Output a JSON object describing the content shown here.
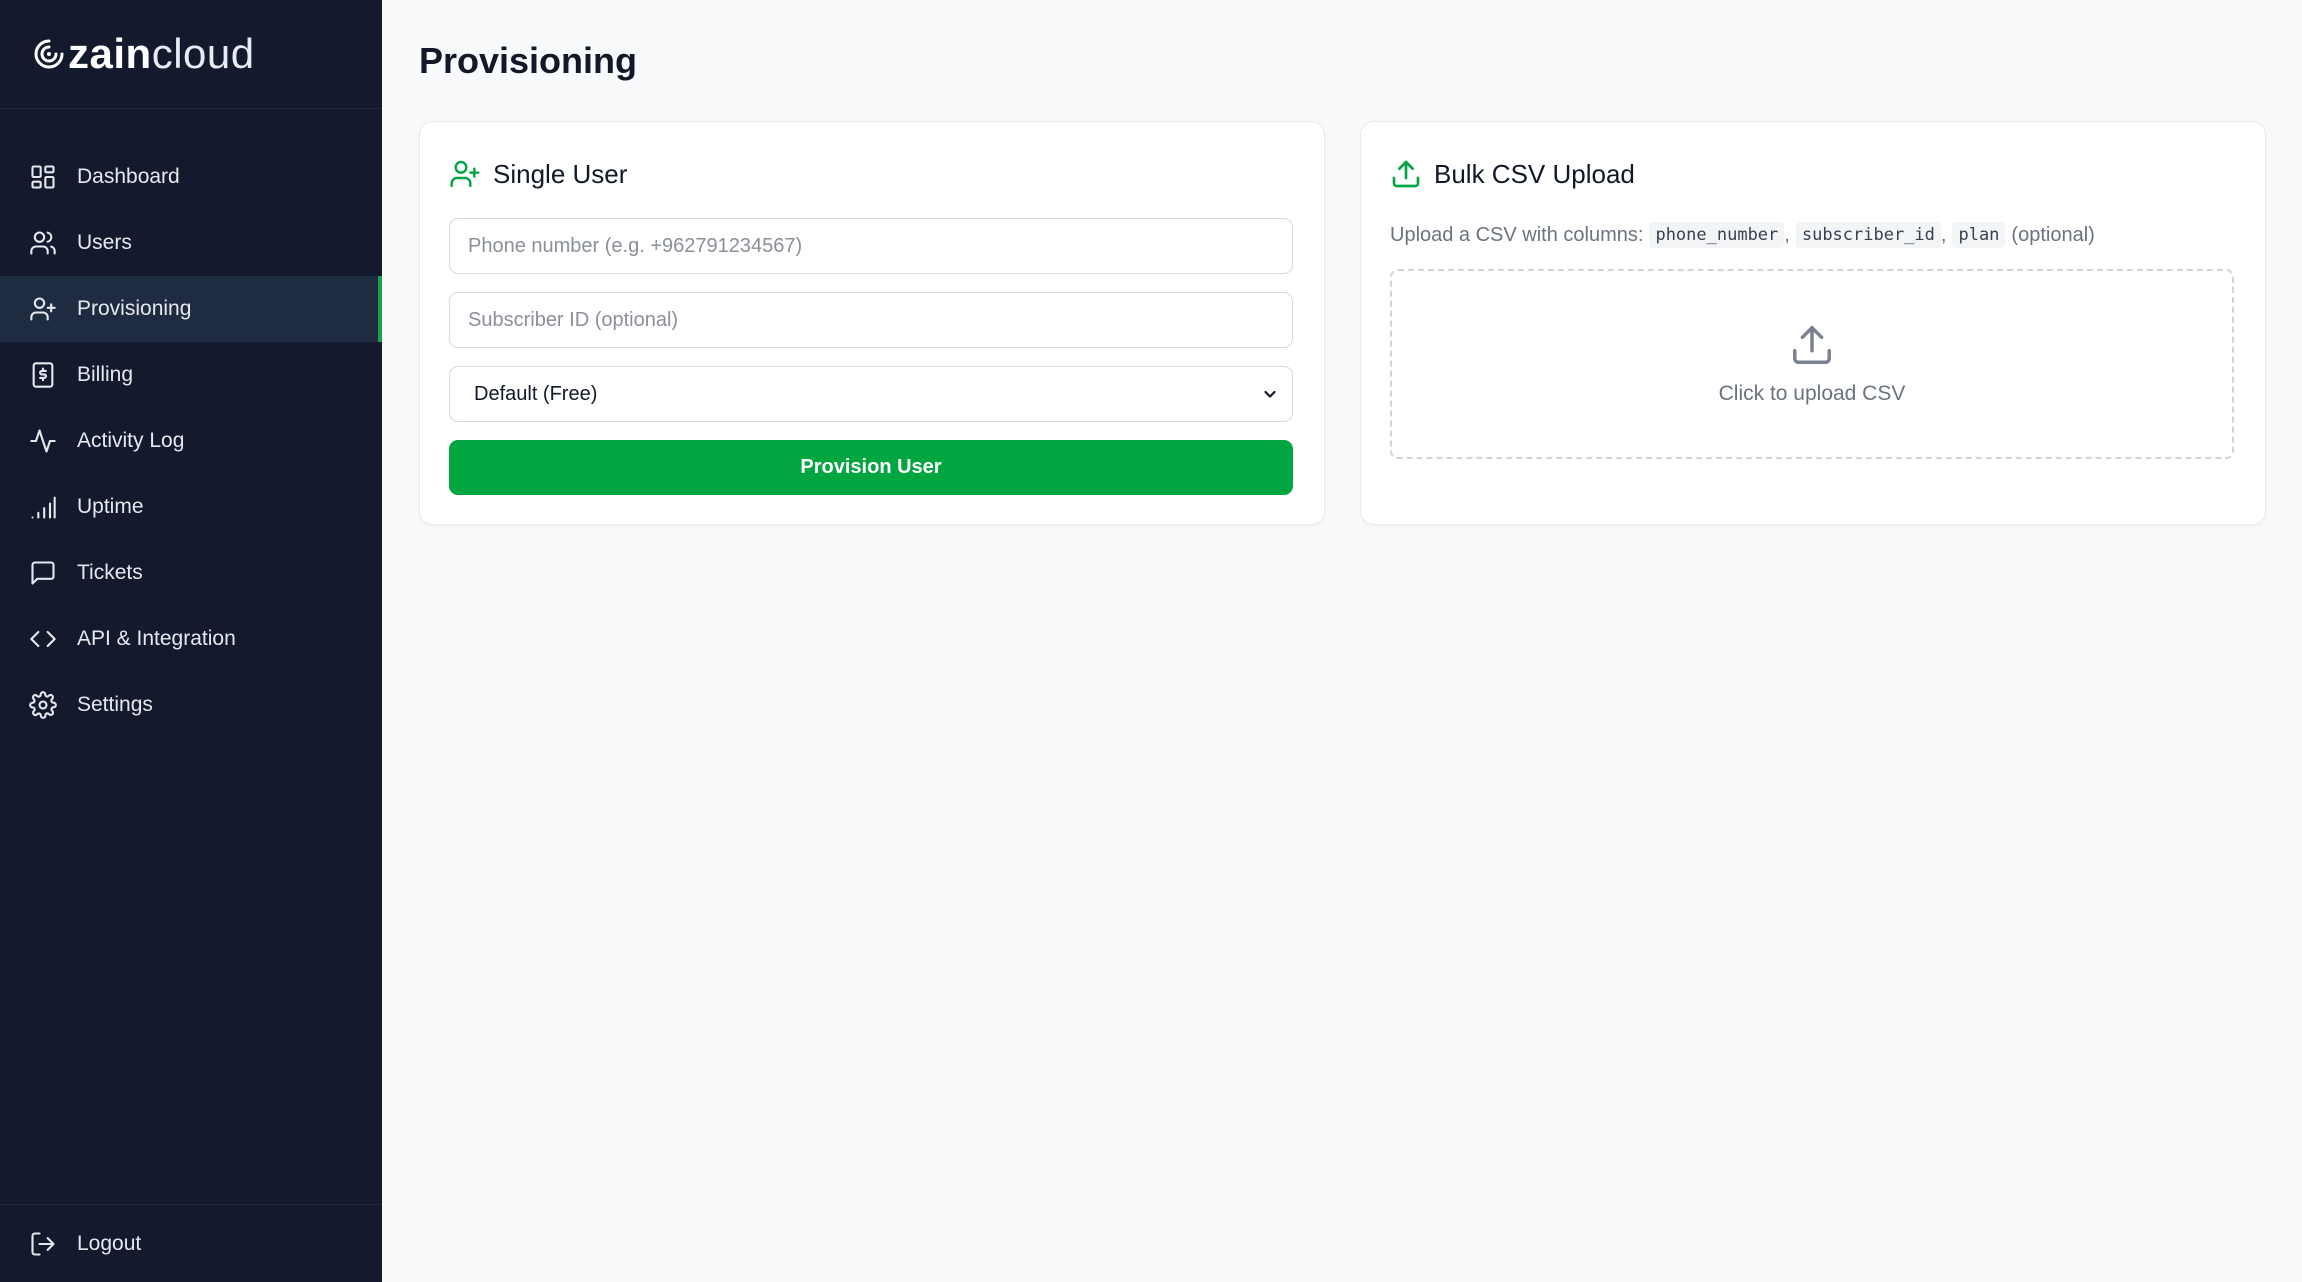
{
  "brand": {
    "bold": "zain",
    "light": "cloud"
  },
  "colors": {
    "sidebar_bg": "#131a2e",
    "accent": "#02a640",
    "active_bg": "#1f2b41"
  },
  "sidebar": {
    "items": [
      {
        "label": "Dashboard",
        "icon": "dashboard-icon"
      },
      {
        "label": "Users",
        "icon": "users-icon"
      },
      {
        "label": "Provisioning",
        "icon": "user-plus-icon",
        "active": true
      },
      {
        "label": "Billing",
        "icon": "receipt-icon"
      },
      {
        "label": "Activity Log",
        "icon": "activity-icon"
      },
      {
        "label": "Uptime",
        "icon": "signal-icon"
      },
      {
        "label": "Tickets",
        "icon": "message-square-icon"
      },
      {
        "label": "API & Integration",
        "icon": "code-icon"
      },
      {
        "label": "Settings",
        "icon": "gear-icon"
      }
    ],
    "logout": {
      "label": "Logout",
      "icon": "logout-icon"
    }
  },
  "page": {
    "title": "Provisioning"
  },
  "single_user": {
    "title": "Single User",
    "phone_placeholder": "Phone number (e.g. +962791234567)",
    "subscriber_placeholder": "Subscriber ID (optional)",
    "plan_selected": "Default (Free)",
    "submit_label": "Provision User"
  },
  "bulk": {
    "title": "Bulk CSV Upload",
    "desc_prefix": "Upload a CSV with columns:",
    "col1": "phone_number",
    "col2": "subscriber_id",
    "col3": "plan",
    "sep": ",",
    "desc_suffix": "(optional)",
    "upload_label": "Click to upload CSV"
  }
}
